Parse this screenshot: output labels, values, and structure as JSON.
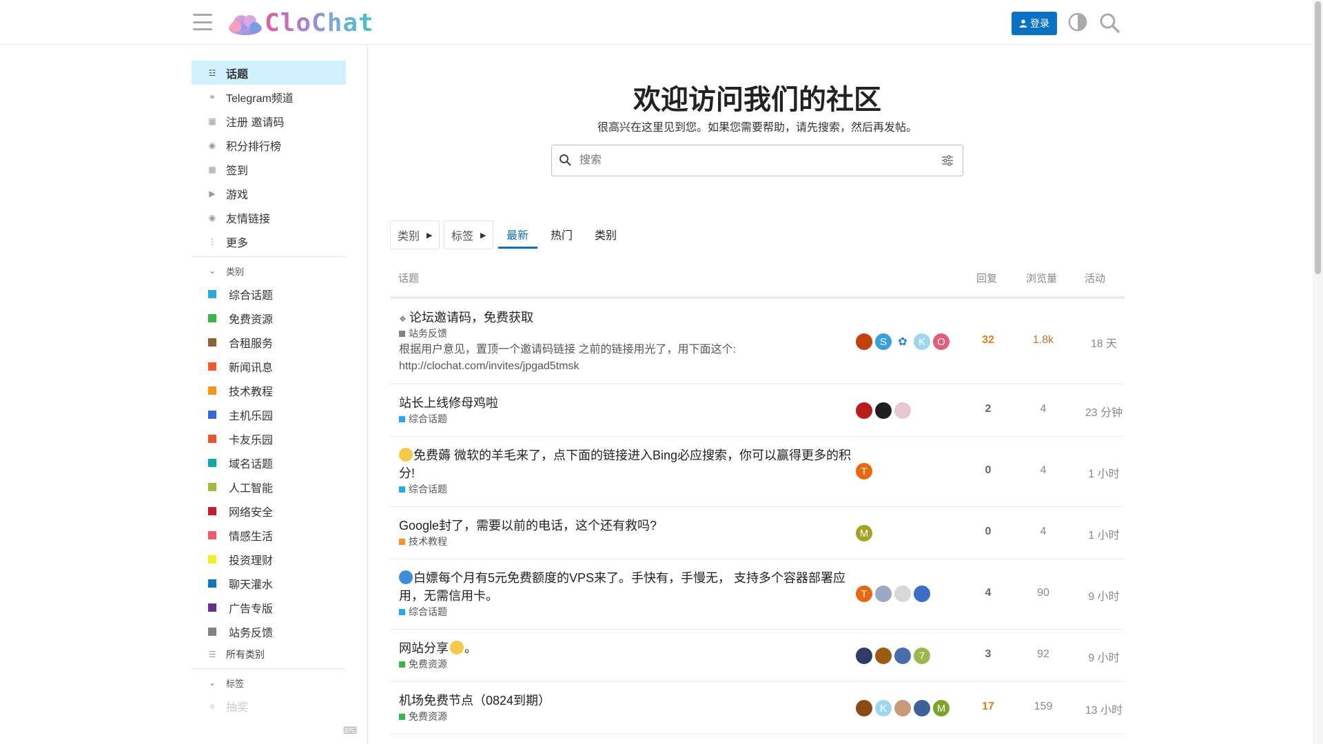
{
  "header": {
    "logo_text": "CloChat",
    "login_label": "登录"
  },
  "sidebar": {
    "nav": [
      {
        "label": "话题",
        "icon": "layers-icon"
      },
      {
        "label": "Telegram频道",
        "icon": "link-icon"
      },
      {
        "label": "注册 邀请码",
        "icon": "gift-icon"
      },
      {
        "label": "积分排行榜",
        "icon": "medal-icon"
      },
      {
        "label": "签到",
        "icon": "calendar-icon"
      },
      {
        "label": "游戏",
        "icon": "play-icon"
      },
      {
        "label": "友情链接",
        "icon": "globe-icon"
      },
      {
        "label": "更多",
        "icon": "ellipsis-icon"
      }
    ],
    "categories_heading": "类别",
    "categories": [
      {
        "label": "综合话题",
        "color": "#25aae2"
      },
      {
        "label": "免费资源",
        "color": "#3ab54a"
      },
      {
        "label": "合租服务",
        "color": "#8c6238"
      },
      {
        "label": "新闻讯息",
        "color": "#f1592a"
      },
      {
        "label": "技术教程",
        "color": "#f7941d"
      },
      {
        "label": "主机乐园",
        "color": "#3566e0"
      },
      {
        "label": "卡友乐园",
        "color": "#e45735"
      },
      {
        "label": "域名话题",
        "color": "#12a89d"
      },
      {
        "label": "人工智能",
        "color": "#a6b739"
      },
      {
        "label": "网络安全",
        "color": "#bf1e2e"
      },
      {
        "label": "情感生活",
        "color": "#f05a6e"
      },
      {
        "label": "投资理财",
        "color": "#eeee22"
      },
      {
        "label": "聊天灌水",
        "color": "#0e76bd"
      },
      {
        "label": "广告专版",
        "color": "#652d90"
      },
      {
        "label": "站务反馈",
        "color": "#808281"
      }
    ],
    "all_categories": "所有类别",
    "tags_heading": "标签",
    "tags_first": "抽奖"
  },
  "welcome": {
    "title": "欢迎访问我们的社区",
    "subtitle": "很高兴在这里见到您。如果您需要帮助，请先搜索，然后再发帖。",
    "search_placeholder": "搜索"
  },
  "nav": {
    "categories_dropdown": "类别",
    "tags_dropdown": "标签",
    "tabs": [
      "最新",
      "热门",
      "类别"
    ]
  },
  "list_headers": {
    "topic": "话题",
    "replies": "回复",
    "views": "浏览量",
    "activity": "活动"
  },
  "topics": [
    {
      "title": "论坛邀请码，免费获取",
      "category": "站务反馈",
      "category_color": "#808281",
      "excerpt": "根据用户意见，置顶一个邀请码链接 之前的链接用光了，用下面这个: http://clochat.com/invites/jpgad5tmsk",
      "replies": "32",
      "views": "1.8k",
      "activity": "18 天"
    },
    {
      "title": "站长上线修母鸡啦",
      "category": "综合话题",
      "category_color": "#25aae2",
      "replies": "2",
      "views": "4",
      "activity": "23 分钟"
    },
    {
      "title": "免费薅 微软的羊毛来了，点下面的链接进入Bing必应搜索，你可以赢得更多的积分!",
      "category": "综合话题",
      "category_color": "#25aae2",
      "replies": "0",
      "views": "4",
      "activity": "1 小时"
    },
    {
      "title": "Google封了，需要以前的电话，这个还有救吗?",
      "category": "技术教程",
      "category_color": "#f7941d",
      "replies": "0",
      "views": "4",
      "activity": "1 小时"
    },
    {
      "title": "白嫖每个月有5元免费额度的VPS来了。手快有，手慢无， 支持多个容器部署应用，无需信用卡。",
      "category": "综合话题",
      "category_color": "#25aae2",
      "replies": "4",
      "views": "90",
      "activity": "9 小时"
    },
    {
      "title": "网站分享",
      "title_suffix": "。",
      "category": "免费资源",
      "category_color": "#3ab54a",
      "replies": "3",
      "views": "92",
      "activity": "9 小时"
    },
    {
      "title": "机场免费节点（0824到期）",
      "category": "免费资源",
      "category_color": "#3ab54a",
      "replies": "17",
      "views": "159",
      "activity": "13 小时"
    }
  ],
  "avatars": {
    "row0": [
      "",
      "S",
      "",
      "K",
      "O"
    ],
    "row3": [
      "M"
    ],
    "row2": [
      "T"
    ],
    "row4": [
      "T"
    ],
    "row5": [
      "",
      "",
      "",
      "7"
    ],
    "row6": [
      "",
      "K",
      "",
      "",
      "M"
    ]
  }
}
